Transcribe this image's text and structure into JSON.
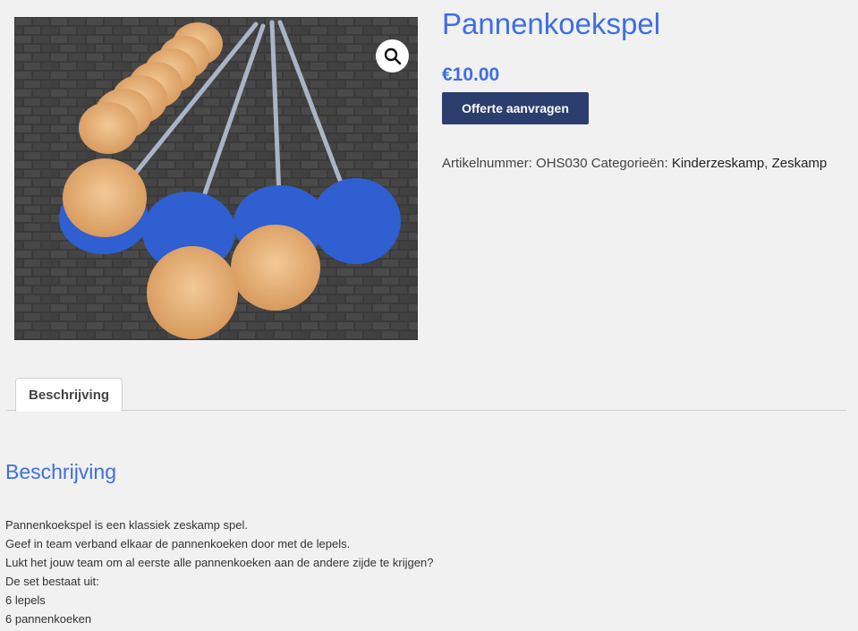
{
  "product": {
    "title": "Pannenkoekspel",
    "price": "€10.00",
    "quote_button_label": "Offerte aanvragen",
    "sku_label": "Artikelnummer:",
    "sku_value": "OHS030",
    "categories_label": "Categorieën:",
    "categories": [
      "Kinderzeskamp",
      "Zeskamp"
    ],
    "categories_separator": ", ",
    "image_icon": "magnifier-zoom-icon"
  },
  "tabs": [
    {
      "label": "Beschrijving",
      "active": true
    }
  ],
  "description": {
    "heading": "Beschrijving",
    "lines": [
      "Pannenkoekspel is een klassiek zeskamp spel.",
      "Geef in team verband elkaar de pannenkoeken door met de lepels.",
      "Lukt het jouw team om al eerste alle pannenkoeken aan de andere zijde te krijgen?",
      "De set bestaat uit:",
      "6 lepels",
      "6 pannenkoeken"
    ]
  },
  "colors": {
    "accent": "#3d6ee6",
    "button_bg": "#2c3e6e",
    "page_bg": "#f1f1f1",
    "spoon_blue": "#2f5fd0",
    "pancake": "#e6b27a"
  }
}
